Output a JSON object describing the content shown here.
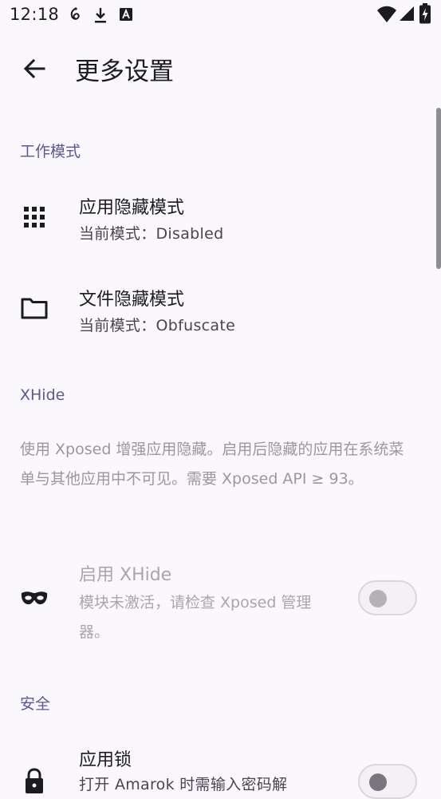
{
  "status_bar": {
    "time": "12:18",
    "left_icons": [
      "hook-icon",
      "download-icon",
      "font-icon"
    ],
    "right_icons": [
      "wifi-icon",
      "signal-icon",
      "battery-charging-icon"
    ]
  },
  "toolbar": {
    "back_icon": "arrow-back-icon",
    "title": "更多设置"
  },
  "sections": {
    "work_mode": {
      "title": "工作模式",
      "items": [
        {
          "icon": "apps-grid-icon",
          "title": "应用隐藏模式",
          "subtitle": "当前模式：Disabled"
        },
        {
          "icon": "folder-icon",
          "title": "文件隐藏模式",
          "subtitle": "当前模式：Obfuscate"
        }
      ]
    },
    "xhide": {
      "title": "XHide",
      "description": "使用 Xposed 增强应用隐藏。启用后隐藏的应用在系统菜单与其他应用中不可见。需要 Xposed API ≥ 93。",
      "toggle": {
        "icon": "mask-icon",
        "title": "启用 XHide",
        "subtitle": "模块未激活，请检查 Xposed 管理器。",
        "state": "off",
        "enabled": false
      }
    },
    "security": {
      "title": "安全",
      "app_lock": {
        "icon": "lock-icon",
        "title": "应用锁",
        "subtitle": "打开 Amarok 时需输入密码解",
        "state": "off"
      }
    }
  },
  "colors": {
    "background": "#fbf8fd",
    "section_title": "#5b5796",
    "text_primary": "#1c1b1f",
    "text_secondary": "#49454f",
    "text_disabled": "#a8a6ac"
  }
}
